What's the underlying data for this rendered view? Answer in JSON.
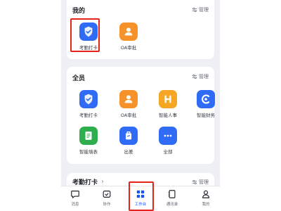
{
  "my_section": {
    "title": "我的",
    "manage_label": "管理",
    "apps": [
      {
        "label": "考勤打卡",
        "icon": "attendance-shield-icon",
        "color": "#2f6bf5"
      },
      {
        "label": "OA审批",
        "icon": "oa-approval-person-icon",
        "color": "#f5922a"
      }
    ]
  },
  "all_section": {
    "title": "全员",
    "manage_label": "管理",
    "apps": [
      {
        "label": "考勤打卡",
        "icon": "attendance-shield-icon",
        "color": "#2f6bf5"
      },
      {
        "label": "OA审批",
        "icon": "oa-approval-person-icon",
        "color": "#f5922a"
      },
      {
        "label": "智能人事",
        "icon": "smart-hr-icon",
        "color": "#f5a623"
      },
      {
        "label": "智能财务",
        "icon": "smart-finance-icon",
        "color": "#2f6bf5"
      },
      {
        "label": "智能填表",
        "icon": "smart-form-icon",
        "color": "#2fae4e"
      },
      {
        "label": "出差",
        "icon": "business-trip-luggage-icon",
        "color": "#2f6bf5"
      },
      {
        "label": "全部",
        "icon": "more-dots-icon",
        "color": "#2f6bf5"
      }
    ]
  },
  "attendance_card": {
    "title": "考勤打卡",
    "chevron": "›",
    "manage_label": "管理"
  },
  "tabbar": {
    "tabs": [
      {
        "label": "消息",
        "icon": "message-icon"
      },
      {
        "label": "协作",
        "icon": "collaboration-icon"
      },
      {
        "label": "工作台",
        "icon": "workbench-grid-icon",
        "active": true
      },
      {
        "label": "通讯录",
        "icon": "contacts-icon"
      },
      {
        "label": "我的",
        "icon": "profile-icon"
      }
    ]
  },
  "colors": {
    "accent": "#1456f0",
    "highlight": "#e5231b"
  }
}
